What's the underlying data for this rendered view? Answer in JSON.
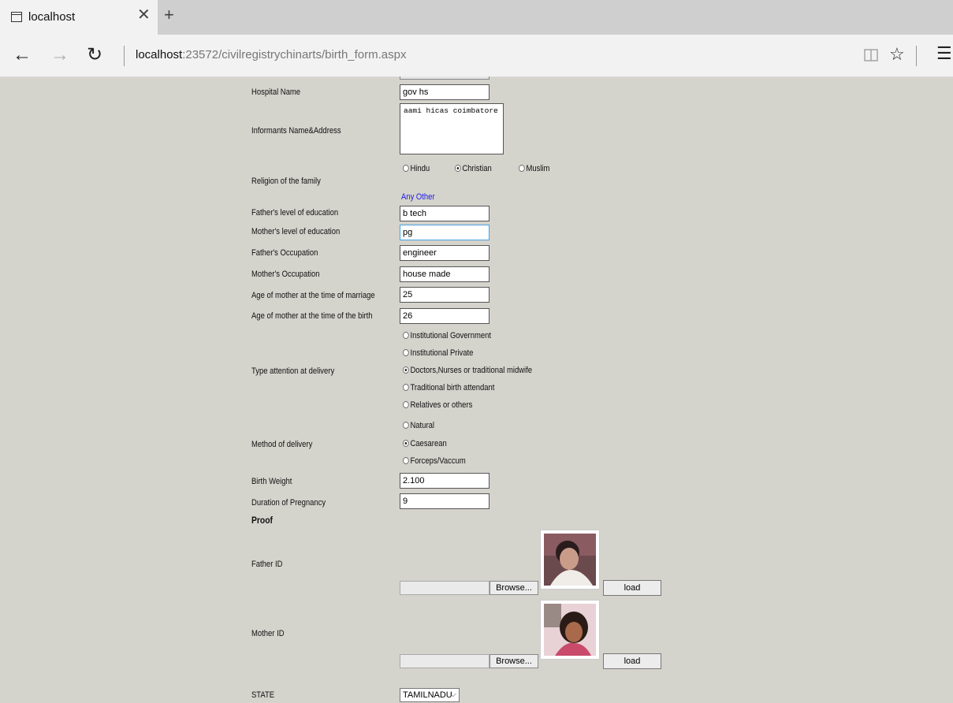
{
  "browser": {
    "tab_title": "localhost",
    "url_host": "localhost",
    "url_path": ":23572/civilregistrychinarts/birth_form.aspx"
  },
  "form": {
    "hospital_name": {
      "label": "Hospital Name",
      "value": "gov hs"
    },
    "informant": {
      "label": "Informants Name&Address",
      "value": "aami hicas coimbatore"
    },
    "religion": {
      "label": "Religion of the family",
      "options": [
        "Hindu",
        "Christian",
        "Muslim"
      ],
      "selected": "Christian",
      "other_link": "Any Other"
    },
    "father_education": {
      "label": "Father's level  of education",
      "value": "b tech"
    },
    "mother_education": {
      "label": "Mother's level  of education",
      "value": "pg"
    },
    "father_occupation": {
      "label": "Father's Occupation",
      "value": "engineer"
    },
    "mother_occupation": {
      "label": "Mother's Occupation",
      "value": "house made"
    },
    "age_marriage": {
      "label": "Age of mother at the time of marriage",
      "value": "25"
    },
    "age_birth": {
      "label": "Age of mother at the time  of the birth",
      "value": "26"
    },
    "attention": {
      "label": "Type attention at delivery",
      "options": [
        "Institutional Government",
        "Institutional Private",
        "Doctors,Nurses or traditional midwife",
        "Traditional birth attendant",
        "Relatives or others"
      ],
      "selected": "Doctors,Nurses or traditional midwife"
    },
    "method": {
      "label": "Method of delivery",
      "options": [
        "Natural",
        "Caesarean",
        "Forceps/Vaccum"
      ],
      "selected": "Caesarean"
    },
    "birth_weight": {
      "label": "Birth Weight",
      "value": "2.100"
    },
    "pregnancy": {
      "label": "Duration of Pregnancy",
      "value": "9"
    },
    "proof_heading": "Proof",
    "father_id": {
      "label": "Father ID",
      "browse": "Browse...",
      "load": "load"
    },
    "mother_id": {
      "label": "Mother ID",
      "browse": "Browse...",
      "load": "load"
    },
    "state": {
      "label": "STATE",
      "value": "TAMILNADU"
    }
  }
}
